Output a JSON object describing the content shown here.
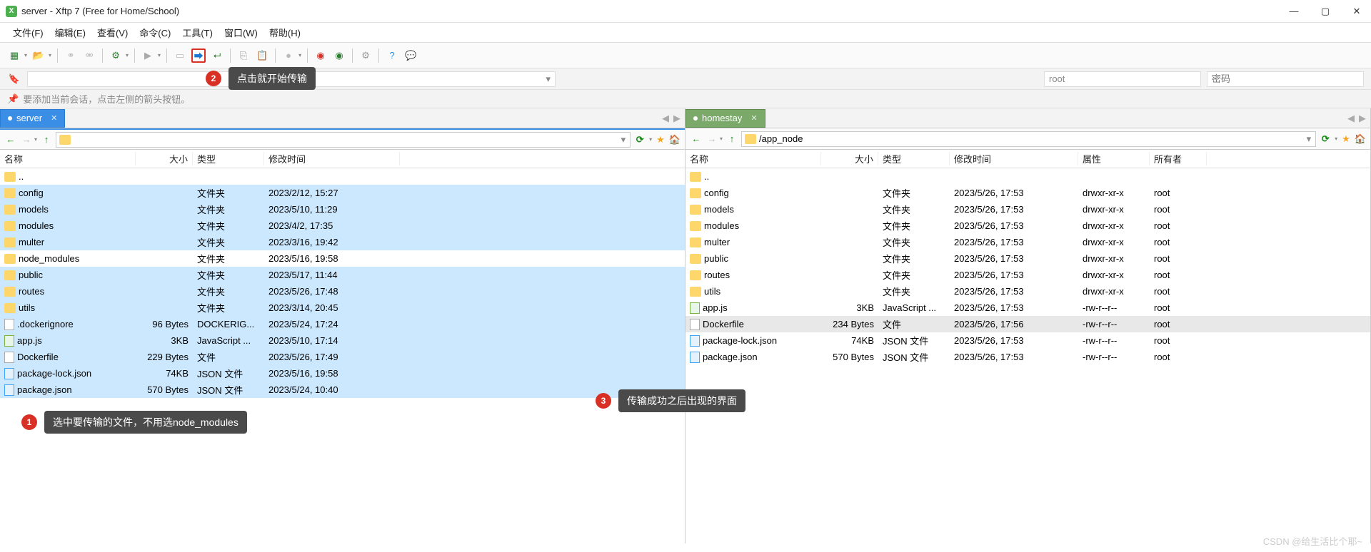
{
  "window": {
    "title": "server - Xftp 7 (Free for Home/School)"
  },
  "menu": [
    "文件(F)",
    "编辑(E)",
    "查看(V)",
    "命令(C)",
    "工具(T)",
    "窗口(W)",
    "帮助(H)"
  ],
  "conn": {
    "user": "root",
    "passPlaceholder": "密码"
  },
  "hint": "要添加当前会话，点击左侧的箭头按钮。",
  "tabs": {
    "local": "server",
    "remote": "homestay"
  },
  "paths": {
    "local": "",
    "remote": "/app_node"
  },
  "headers": {
    "name": "名称",
    "size": "大小",
    "type": "类型",
    "date": "修改时间",
    "attr": "属性",
    "owner": "所有者"
  },
  "typeLabels": {
    "folder": "文件夹",
    "file": "文件",
    "js": "JavaScript ...",
    "json": "JSON 文件",
    "dockerig": "DOCKERIG..."
  },
  "localFiles": [
    {
      "n": "..",
      "s": "",
      "t": "",
      "d": "",
      "icon": "f",
      "sel": false
    },
    {
      "n": "config",
      "s": "",
      "t": "folder",
      "d": "2023/2/12, 15:27",
      "icon": "f",
      "sel": true
    },
    {
      "n": "models",
      "s": "",
      "t": "folder",
      "d": "2023/5/10, 11:29",
      "icon": "f",
      "sel": true
    },
    {
      "n": "modules",
      "s": "",
      "t": "folder",
      "d": "2023/4/2, 17:35",
      "icon": "f",
      "sel": true
    },
    {
      "n": "multer",
      "s": "",
      "t": "folder",
      "d": "2023/3/16, 19:42",
      "icon": "f",
      "sel": true
    },
    {
      "n": "node_modules",
      "s": "",
      "t": "folder",
      "d": "2023/5/16, 19:58",
      "icon": "f",
      "sel": false
    },
    {
      "n": "public",
      "s": "",
      "t": "folder",
      "d": "2023/5/17, 11:44",
      "icon": "f",
      "sel": true
    },
    {
      "n": "routes",
      "s": "",
      "t": "folder",
      "d": "2023/5/26, 17:48",
      "icon": "f",
      "sel": true
    },
    {
      "n": "utils",
      "s": "",
      "t": "folder",
      "d": "2023/3/14, 20:45",
      "icon": "f",
      "sel": true
    },
    {
      "n": ".dockerignore",
      "s": "96 Bytes",
      "t": "dockerig",
      "d": "2023/5/24, 17:24",
      "icon": "file",
      "sel": true
    },
    {
      "n": "app.js",
      "s": "3KB",
      "t": "js",
      "d": "2023/5/10, 17:14",
      "icon": "js",
      "sel": true
    },
    {
      "n": "Dockerfile",
      "s": "229 Bytes",
      "t": "file",
      "d": "2023/5/26, 17:49",
      "icon": "file",
      "sel": true
    },
    {
      "n": "package-lock.json",
      "s": "74KB",
      "t": "json",
      "d": "2023/5/16, 19:58",
      "icon": "json",
      "sel": true
    },
    {
      "n": "package.json",
      "s": "570 Bytes",
      "t": "json",
      "d": "2023/5/24, 10:40",
      "icon": "json",
      "sel": true
    }
  ],
  "remoteFiles": [
    {
      "n": "..",
      "s": "",
      "t": "",
      "d": "",
      "a": "",
      "o": "",
      "icon": "f",
      "sel": false
    },
    {
      "n": "config",
      "s": "",
      "t": "folder",
      "d": "2023/5/26, 17:53",
      "a": "drwxr-xr-x",
      "o": "root",
      "icon": "f"
    },
    {
      "n": "models",
      "s": "",
      "t": "folder",
      "d": "2023/5/26, 17:53",
      "a": "drwxr-xr-x",
      "o": "root",
      "icon": "f"
    },
    {
      "n": "modules",
      "s": "",
      "t": "folder",
      "d": "2023/5/26, 17:53",
      "a": "drwxr-xr-x",
      "o": "root",
      "icon": "f"
    },
    {
      "n": "multer",
      "s": "",
      "t": "folder",
      "d": "2023/5/26, 17:53",
      "a": "drwxr-xr-x",
      "o": "root",
      "icon": "f"
    },
    {
      "n": "public",
      "s": "",
      "t": "folder",
      "d": "2023/5/26, 17:53",
      "a": "drwxr-xr-x",
      "o": "root",
      "icon": "f"
    },
    {
      "n": "routes",
      "s": "",
      "t": "folder",
      "d": "2023/5/26, 17:53",
      "a": "drwxr-xr-x",
      "o": "root",
      "icon": "f"
    },
    {
      "n": "utils",
      "s": "",
      "t": "folder",
      "d": "2023/5/26, 17:53",
      "a": "drwxr-xr-x",
      "o": "root",
      "icon": "f"
    },
    {
      "n": "app.js",
      "s": "3KB",
      "t": "js",
      "d": "2023/5/26, 17:53",
      "a": "-rw-r--r--",
      "o": "root",
      "icon": "js"
    },
    {
      "n": "Dockerfile",
      "s": "234 Bytes",
      "t": "file",
      "d": "2023/5/26, 17:56",
      "a": "-rw-r--r--",
      "o": "root",
      "icon": "file",
      "sel": true
    },
    {
      "n": "package-lock.json",
      "s": "74KB",
      "t": "json",
      "d": "2023/5/26, 17:53",
      "a": "-rw-r--r--",
      "o": "root",
      "icon": "json"
    },
    {
      "n": "package.json",
      "s": "570 Bytes",
      "t": "json",
      "d": "2023/5/26, 17:53",
      "a": "-rw-r--r--",
      "o": "root",
      "icon": "json"
    }
  ],
  "callouts": {
    "c1": "选中要传输的文件，不用选node_modules",
    "c2": "点击就开始传输",
    "c3": "传输成功之后出现的界面"
  },
  "watermark": "CSDN @给生活比个耶~"
}
